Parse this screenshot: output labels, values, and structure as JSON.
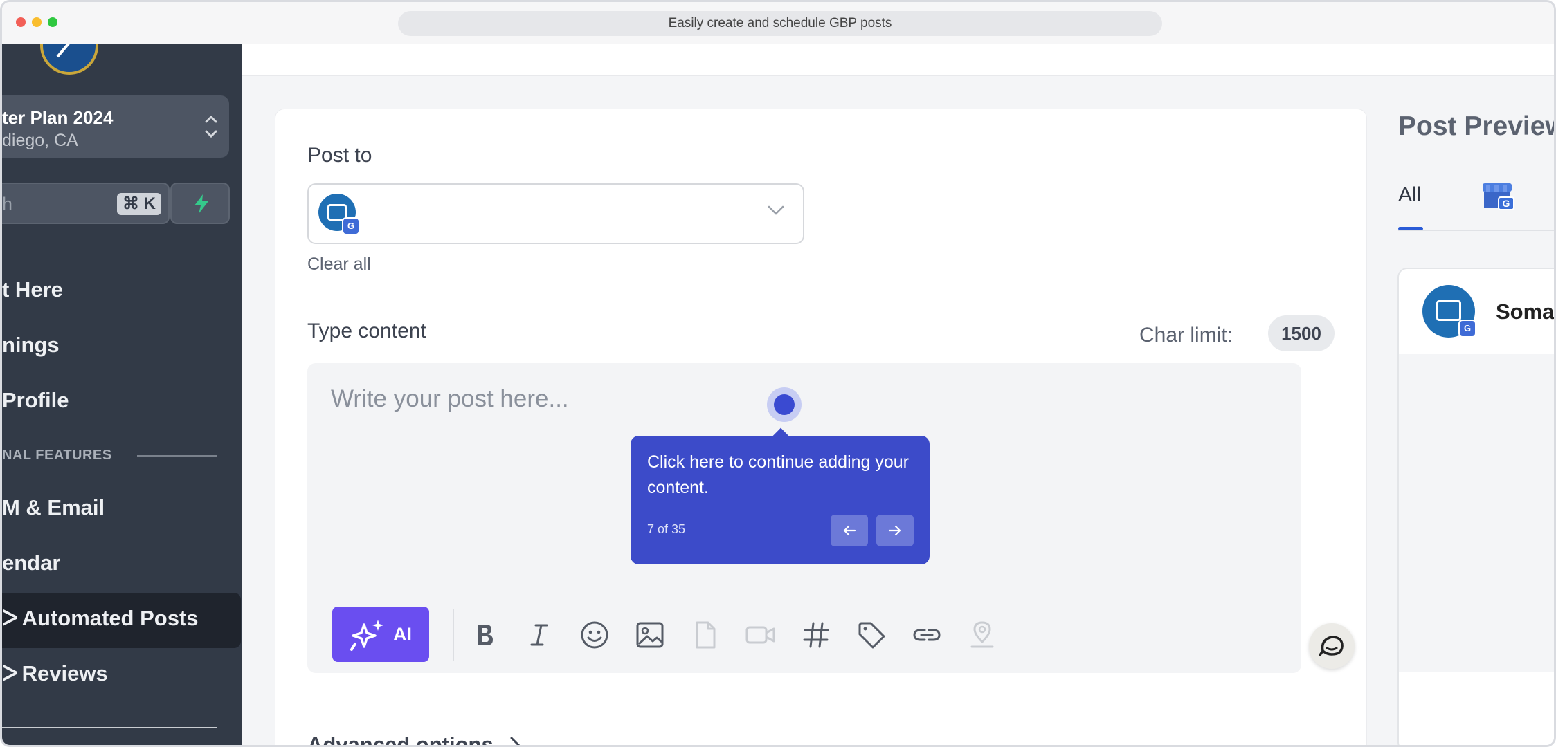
{
  "window": {
    "url_title": "Easily create and schedule GBP posts"
  },
  "sidebar": {
    "location": {
      "name": "ter Plan 2024",
      "city": "diego, CA"
    },
    "search": {
      "placeholder": "h",
      "shortcut": "⌘ K"
    },
    "items": [
      {
        "label": "t Here"
      },
      {
        "label": "nings"
      },
      {
        "label": "Profile"
      },
      {
        "label": "M & Email"
      },
      {
        "label": "endar"
      },
      {
        "label": "Automated Posts",
        "active": true
      },
      {
        "label": "Reviews"
      }
    ],
    "section_label": "NAL FEATURES"
  },
  "form": {
    "post_to_label": "Post to",
    "clear_all": "Clear all",
    "type_content_label": "Type content",
    "char_limit_label": "Char limit:",
    "char_limit_value": "1500",
    "editor_placeholder": "Write your post here...",
    "ai_label": "AI",
    "advanced_options": "Advanced options"
  },
  "toolbar_icons": [
    "bold-icon",
    "italic-icon",
    "emoji-icon",
    "image-icon",
    "file-icon",
    "video-icon",
    "hashtag-icon",
    "tag-icon",
    "link-icon",
    "location-icon"
  ],
  "tooltip": {
    "text": "Click here to continue adding your content.",
    "step": "7 of 35"
  },
  "preview": {
    "title": "Post Preview",
    "tabs": [
      {
        "label": "All"
      }
    ],
    "business_name": "Somat"
  },
  "colors": {
    "sidebar_bg": "#323a47",
    "accent_purple": "#6a4ef0",
    "tooltip_bg": "#3c4bc9",
    "tab_underline": "#2a5bd7"
  }
}
